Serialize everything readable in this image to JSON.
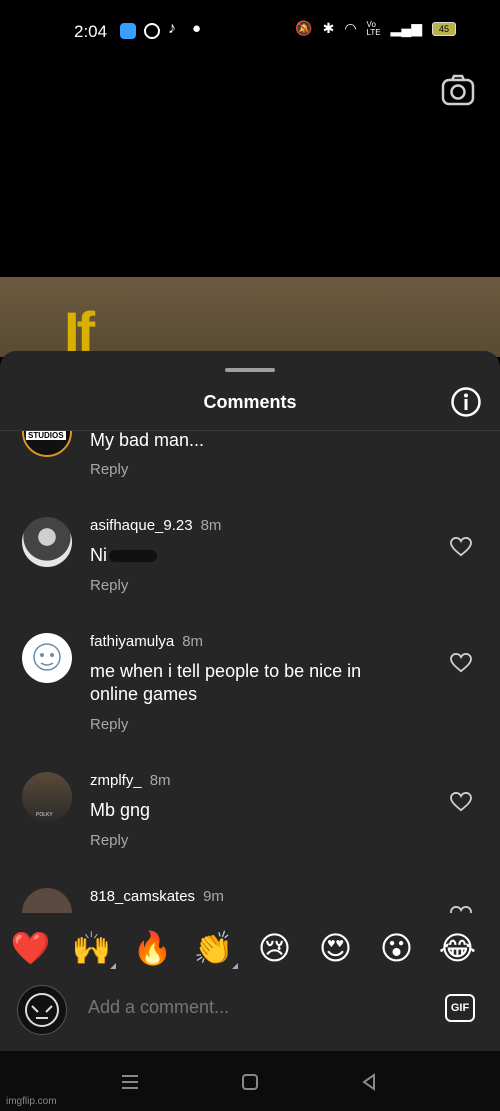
{
  "status_bar": {
    "time": "2:04",
    "network": "Vo LTE",
    "battery": "45"
  },
  "video": {
    "overlay_text": "If"
  },
  "sheet": {
    "title": "Comments"
  },
  "comments": [
    {
      "username": "",
      "time": "",
      "text": "My bad man...",
      "reply": "Reply",
      "avatar_label": "STUDIOS"
    },
    {
      "username": "asifhaque_9.23",
      "time": "8m",
      "text": "Ni",
      "reply": "Reply"
    },
    {
      "username": "fathiyamulya",
      "time": "8m",
      "text": "me when i tell people to be nice in online games",
      "reply": "Reply"
    },
    {
      "username": "zmplfy_",
      "time": "8m",
      "text": "Mb gng",
      "reply": "Reply",
      "avatar_label": "POLKY"
    },
    {
      "username": "818_camskates",
      "time": "9m",
      "text": "",
      "reply": ""
    }
  ],
  "emoji_bar": [
    "❤️",
    "🙌",
    "🔥",
    "👏",
    "😢",
    "😍",
    "😮",
    "😂"
  ],
  "composer": {
    "placeholder": "Add a comment...",
    "gif_label": "GIF"
  },
  "watermark": "imgflip.com",
  "colors": {
    "sheet_bg": "#262626",
    "secondary_text": "#a8a8a8"
  }
}
